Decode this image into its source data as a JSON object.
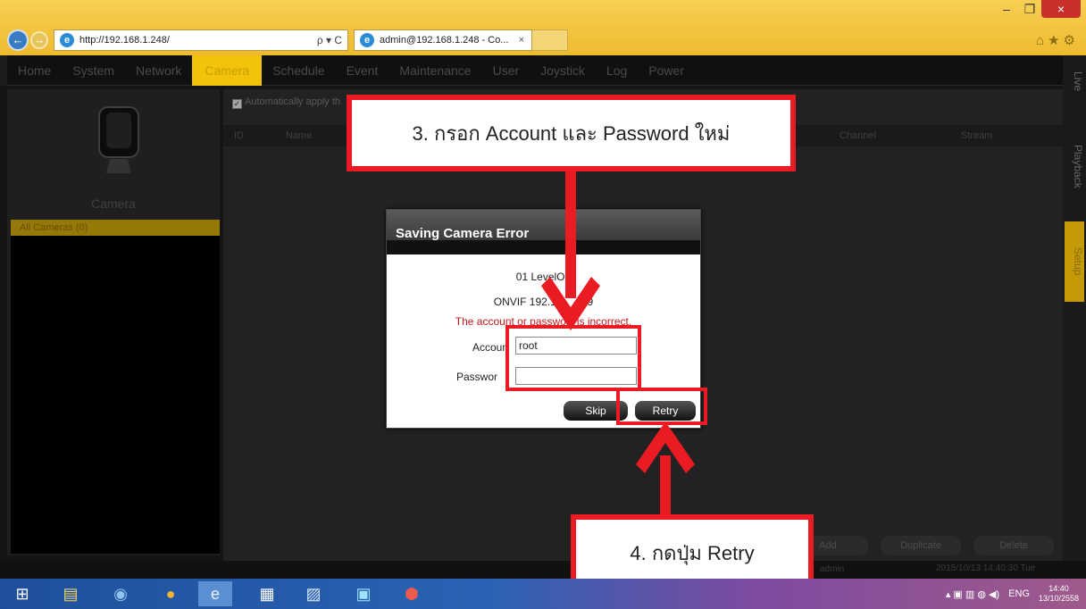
{
  "browser": {
    "window_buttons": [
      "–",
      "❐",
      "×"
    ],
    "address": "http://192.168.1.248/",
    "address_tools": "ρ ▾ C",
    "tab_title": "admin@192.168.1.248 - Co...",
    "tab_close": "×",
    "right_icons": "⌂★⚙"
  },
  "menu": [
    "Home",
    "System",
    "Network",
    "Camera",
    "Schedule",
    "Event",
    "Maintenance",
    "User",
    "Joystick",
    "Log",
    "Power"
  ],
  "left": {
    "title": "Camera",
    "all_cameras": "All Cameras (0)"
  },
  "main": {
    "auto_apply": "Automatically apply th",
    "columns": [
      "ID",
      "Name",
      "Channel",
      "Stream"
    ],
    "actions": [
      "Add",
      "Duplicate",
      "Delete"
    ]
  },
  "side_tabs": [
    "Live",
    "Playback",
    "Setup"
  ],
  "status": {
    "user": "admin",
    "time": "2015/10/13 14:40:30 Tue"
  },
  "dialog": {
    "title": "Saving Camera Error",
    "camera_name": "01 LevelOn",
    "onvif": "ONVIF 192.16",
    "onvif_tail": "9",
    "error": "The account or passwor",
    "error_tail": "is incorrect.",
    "account_label": "Accoun",
    "account_value": "root",
    "password_label": "Passwor",
    "password_value": "",
    "skip": "Skip",
    "retry": "Retry"
  },
  "annotations": {
    "step3": "3. กรอก Account และ Password ใหม่",
    "step4": "4. กดปุ่ม Retry"
  },
  "taskbar": {
    "tray_lang": "ENG",
    "clock_time": "14:40",
    "clock_date": "13/10/2558"
  },
  "colors": {
    "annotation_red": "#ea1b23",
    "accent_yellow": "#f3c20a",
    "error_red": "#c8161d"
  }
}
